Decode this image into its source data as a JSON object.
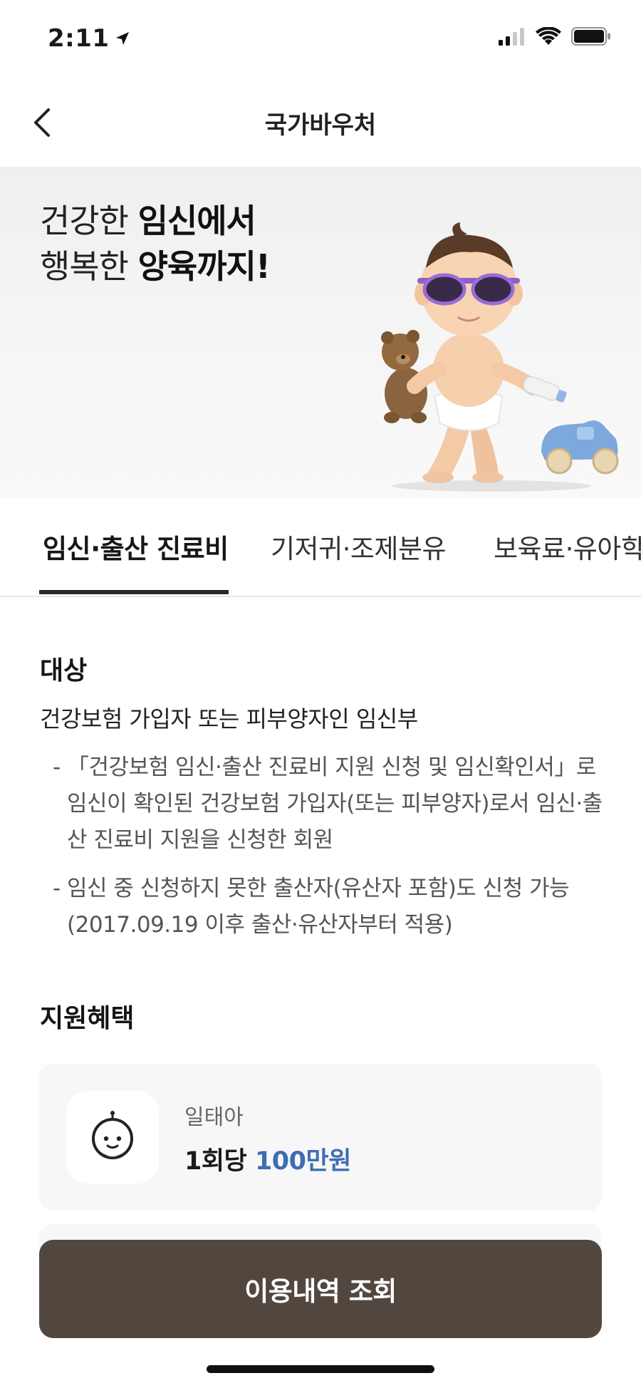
{
  "status_bar": {
    "time": "2:11"
  },
  "nav": {
    "title": "국가바우처"
  },
  "hero": {
    "line1_normal": "건강한 ",
    "line1_bold": "임신에서",
    "line2_normal": "행복한 ",
    "line2_bold": "양육까지!"
  },
  "tabs": [
    {
      "label": "임신·출산 진료비",
      "active": true
    },
    {
      "label": "기저귀·조제분유",
      "active": false
    },
    {
      "label": "보육료·유아학",
      "active": false
    }
  ],
  "target_section": {
    "title": "대상",
    "main": "건강보험 가입자 또는 피부양자인 임신부",
    "bullets": [
      "「건강보험 임신·출산 진료비 지원 신청 및 임신확인서」로 임신이 확인된 건강보험 가입자(또는 피부양자)로서 임신·출산 진료비 지원을 신청한 회원",
      "임신 중 신청하지 못한 출산자(유산자 포함)도 신청 가능 (2017.09.19 이후 출산·유산자부터 적용)"
    ],
    "dash": "-"
  },
  "benefit_section": {
    "title": "지원혜택",
    "card": {
      "label": "일태아",
      "value_prefix": "1회당 ",
      "value_amount": "100만원",
      "icon": "baby-face-icon"
    }
  },
  "cta": {
    "label": "이용내역 조회"
  },
  "colors": {
    "accent": "#3f6db3",
    "cta_bg": "#52473f",
    "tab_indicator": "#2a2a2a"
  }
}
